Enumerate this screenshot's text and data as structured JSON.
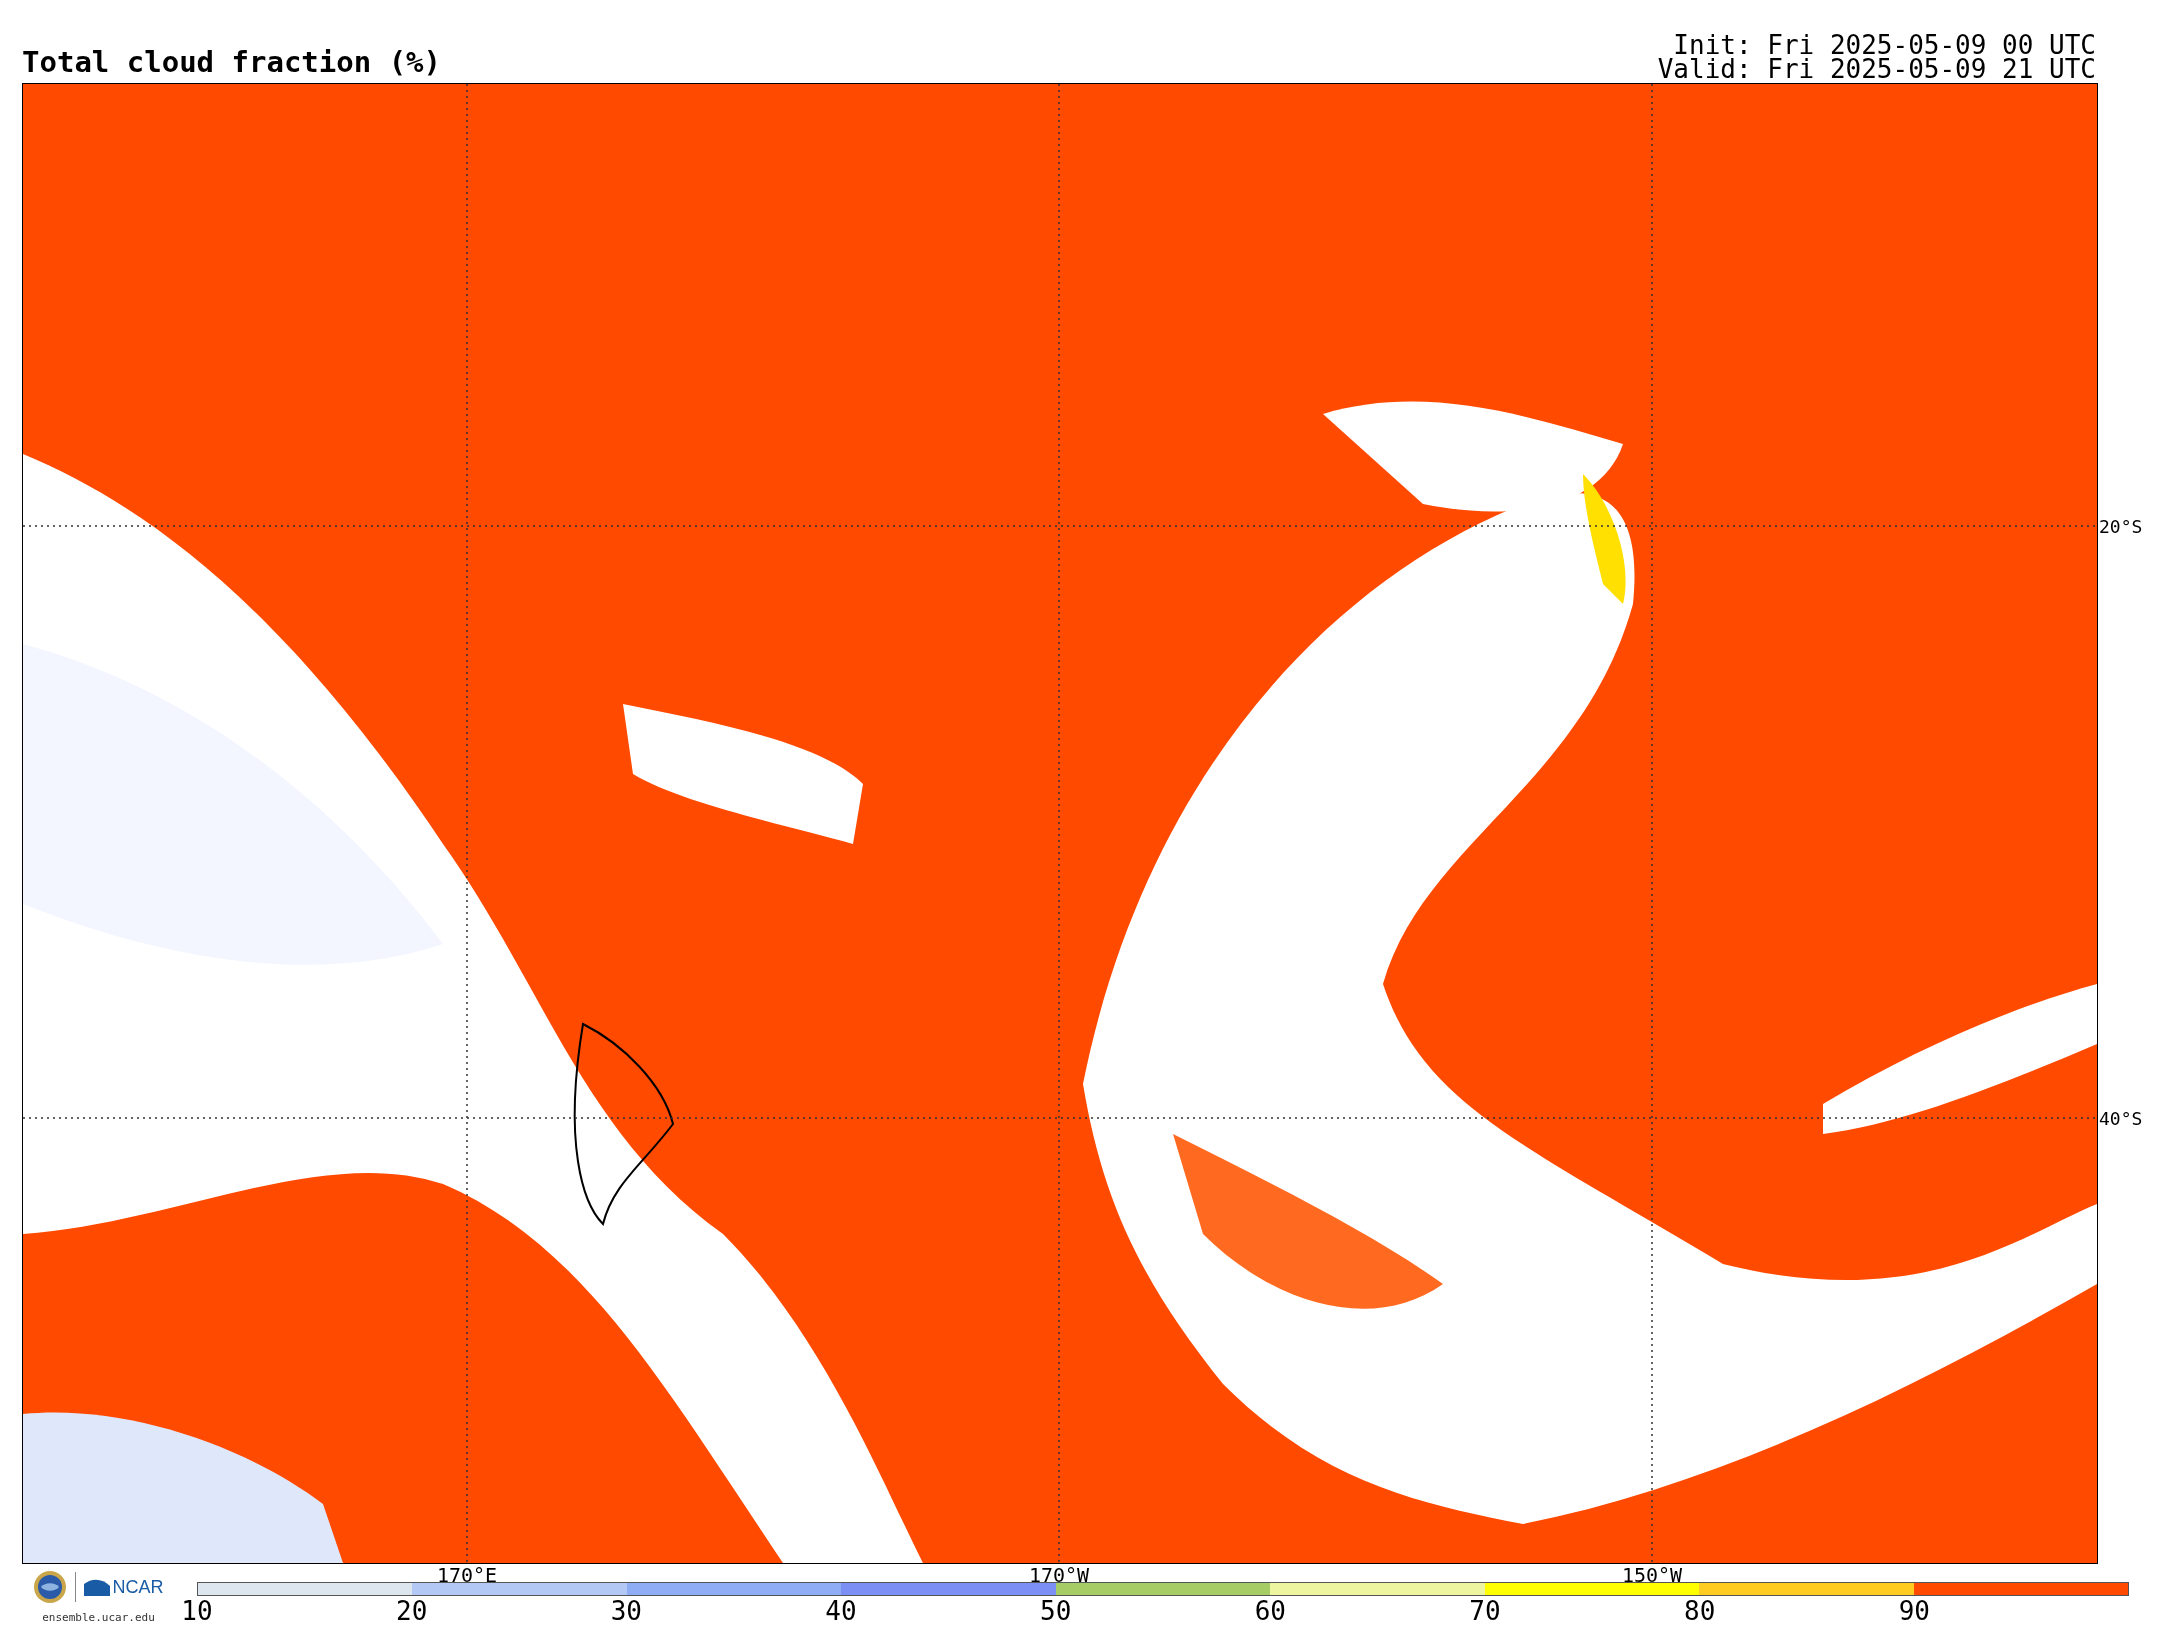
{
  "title": "Total cloud fraction (%)",
  "init": "Init: Fri 2025-05-09 00 UTC",
  "valid": "Valid: Fri 2025-05-09 21 UTC",
  "map": {
    "lat_labels": [
      "20°S",
      "40°S"
    ],
    "lon_labels": [
      "170°E",
      "170°W",
      "150°W"
    ]
  },
  "logo": {
    "ncar": "NCAR",
    "site": "ensemble.ucar.edu"
  },
  "colorbar": {
    "ticks": [
      "10",
      "20",
      "30",
      "40",
      "50",
      "60",
      "70",
      "80",
      "90"
    ],
    "segments": [
      {
        "color": "#dde6ee"
      },
      {
        "color": "#b3c8f5"
      },
      {
        "color": "#8fadf5"
      },
      {
        "color": "#7b8ff5"
      },
      {
        "color": "#a6cc66"
      },
      {
        "color": "#eef5a0"
      },
      {
        "color": "#ffff00"
      },
      {
        "color": "#ffcc22"
      },
      {
        "color": "#ff4a00"
      }
    ]
  }
}
